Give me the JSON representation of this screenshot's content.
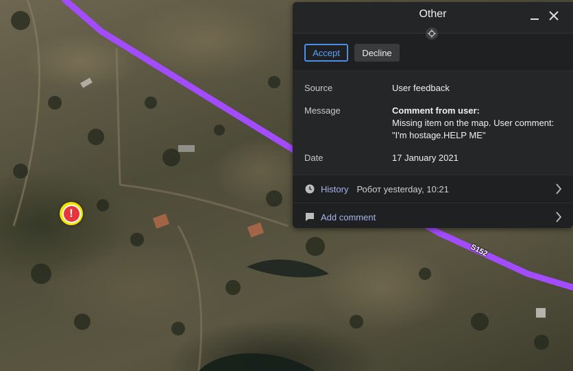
{
  "panel": {
    "title": "Other",
    "accept_label": "Accept",
    "decline_label": "Decline",
    "fields": [
      {
        "label": "Source",
        "value": "User feedback"
      },
      {
        "label": "Message",
        "value_bold": "Comment from user:",
        "value": "Missing item on the map. User comment: \"I'm hostage.HELP ME\""
      },
      {
        "label": "Date",
        "value": "17 January 2021"
      }
    ],
    "history": {
      "label": "History",
      "meta": "Робот yesterday, 10:21"
    },
    "add_comment": {
      "label": "Add comment"
    }
  },
  "map": {
    "road_label": "S152",
    "road_color": "#a34bff"
  },
  "colors": {
    "accent": "#4a8fe8",
    "marker_outer": "#f5e400",
    "marker_inner": "#e8353a"
  },
  "icons": [
    "minimize-icon",
    "close-icon",
    "crosshair-icon",
    "clock-icon",
    "comment-icon",
    "chevron-right-icon",
    "alert-icon"
  ]
}
